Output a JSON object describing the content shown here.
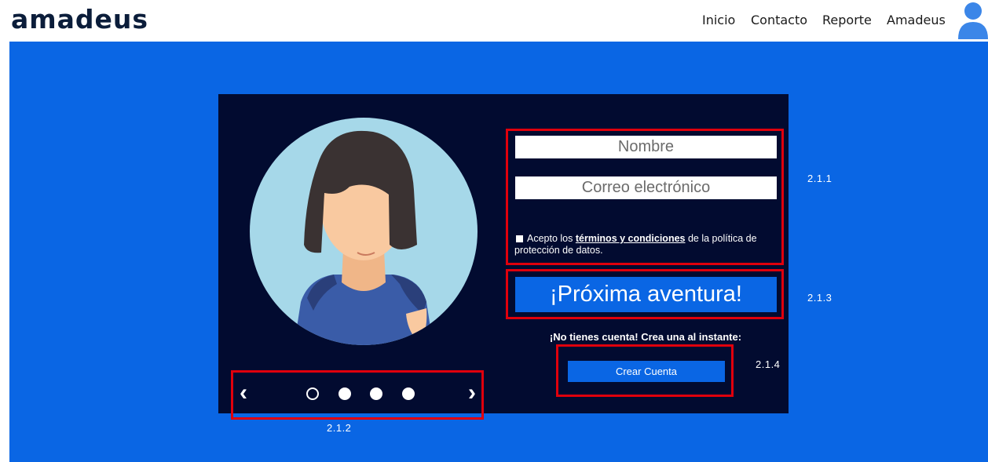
{
  "header": {
    "logo_text": "amadeus",
    "nav": [
      "Inicio",
      "Contacto",
      "Reporte",
      "Amadeus"
    ],
    "user_icon": "user-icon"
  },
  "form": {
    "name_placeholder": "Nombre",
    "email_placeholder": "Correo electrónico",
    "terms_pre": "Acepto los",
    "terms_link": "términos y condiciones",
    "terms_post": "de la política de protección de datos.",
    "submit_label": "¡Próxima aventura!",
    "no_account_text": "¡No tienes cuenta! Crea una al instante:",
    "create_account_label": "Crear Cuenta"
  },
  "carousel": {
    "prev_icon": "‹",
    "next_icon": "›",
    "active_index": 0,
    "dot_count": 4
  },
  "annotations": {
    "a211": "2.1.1",
    "a212": "2.1.2",
    "a213": "2.1.3",
    "a214": "2.1.4"
  },
  "colors": {
    "brand_blue": "#0a66e4",
    "panel_navy": "#020b30",
    "annotation_red": "#e0000c",
    "avatar_circle": "#a6d8e9",
    "hair": "#3a3232",
    "skin": "#f9c9a0",
    "shirt": "#3a5ca8"
  }
}
